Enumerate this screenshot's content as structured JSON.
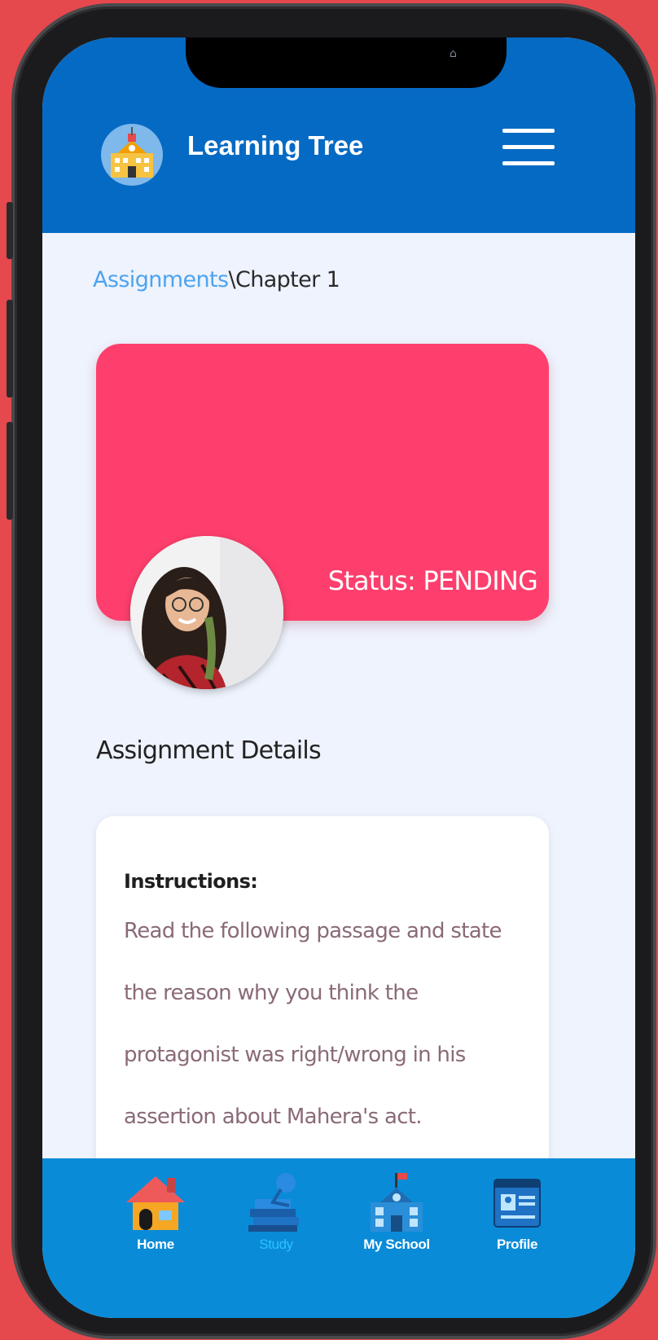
{
  "app": {
    "title": "Learning Tree"
  },
  "breadcrumb": {
    "parent": "Assignments",
    "separator": "\\",
    "current": "Chapter 1"
  },
  "status_card": {
    "status_text": "Status: PENDING"
  },
  "details": {
    "section_title": "Assignment Details",
    "instructions_label": "Instructions:",
    "instructions_lines": [
      "Read the following passage and state",
      "the reason why you think the",
      "protagonist was right/wrong in his",
      "assertion about Mahera's act."
    ]
  },
  "bottom_nav": {
    "items": [
      {
        "label": "Home",
        "icon": "home-icon"
      },
      {
        "label": "Study",
        "icon": "study-icon",
        "active": true
      },
      {
        "label": "My School",
        "icon": "school-icon"
      },
      {
        "label": "Profile",
        "icon": "profile-icon"
      }
    ]
  },
  "colors": {
    "header": "#056ac4",
    "status_card": "#fe3f6d",
    "nav_bar": "#0a8bd8",
    "link": "#4ea3ef",
    "active_nav": "#29c3ff"
  }
}
